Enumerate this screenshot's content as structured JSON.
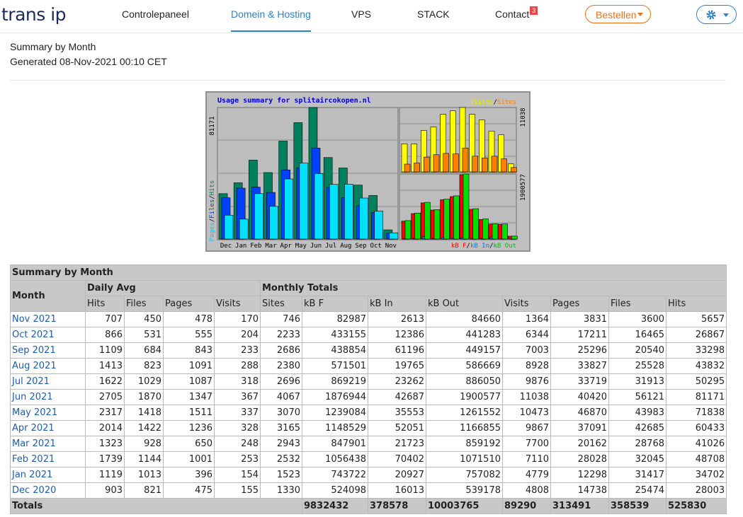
{
  "nav": {
    "logo": "trans ip",
    "items": [
      "Controlepaneel",
      "Domein & Hosting",
      "VPS",
      "STACK",
      "Contact"
    ],
    "contact_badge": "3",
    "order_label": "Bestellen"
  },
  "report": {
    "title": "Summary by Month",
    "generated": "Generated 08-Nov-2021 00:10 CET"
  },
  "colors": {
    "hits": "#00805c",
    "files": "#0040ff",
    "pages": "#00e0ff",
    "visits": "#ffff00",
    "sites": "#ff8000",
    "kbf": "#ff0000",
    "kbin": "#0080ff",
    "kbout": "#00e000"
  },
  "chart_data": {
    "type": "bar",
    "title": "Usage summary for splitaircokopen.nl",
    "categories": [
      "Dec",
      "Jan",
      "Feb",
      "Mar",
      "Apr",
      "May",
      "Jun",
      "Jul",
      "Aug",
      "Sep",
      "Oct",
      "Nov"
    ],
    "left_axis_max_label": "81171",
    "left_axis_legend": [
      "Pages",
      "Files",
      "Hits"
    ],
    "top_right_axis_max_label": "11038",
    "top_right_legend": [
      "Visits",
      "Sites"
    ],
    "bottom_right_axis_max_label": "1900577",
    "bottom_right_legend": [
      "kB F",
      "kB In",
      "kB Out"
    ],
    "series": [
      {
        "name": "Hits",
        "values": [
          28003,
          34702,
          48708,
          41026,
          60433,
          71838,
          81171,
          50295,
          43832,
          33298,
          26867,
          5657
        ]
      },
      {
        "name": "Files",
        "values": [
          25474,
          31417,
          32045,
          28768,
          42685,
          43983,
          56121,
          31913,
          25528,
          20540,
          16465,
          3600
        ]
      },
      {
        "name": "Pages",
        "values": [
          14738,
          12298,
          28028,
          20162,
          37091,
          46870,
          40420,
          33719,
          33827,
          25296,
          17211,
          3831
        ]
      },
      {
        "name": "Visits",
        "values": [
          4808,
          4779,
          7110,
          7700,
          9867,
          10473,
          11038,
          9876,
          8928,
          7003,
          6344,
          1364
        ]
      },
      {
        "name": "Sites",
        "values": [
          1330,
          1523,
          2532,
          2943,
          3165,
          3070,
          4067,
          2696,
          2380,
          2686,
          2233,
          746
        ]
      },
      {
        "name": "kB F",
        "values": [
          524098,
          743722,
          1056438,
          847901,
          1148529,
          1239084,
          1876944,
          869219,
          571501,
          438854,
          433155,
          82987
        ]
      },
      {
        "name": "kB In",
        "values": [
          16013,
          20927,
          70402,
          21723,
          52051,
          35553,
          42687,
          23262,
          19765,
          61196,
          12386,
          2613
        ]
      },
      {
        "name": "kB Out",
        "values": [
          539178,
          757082,
          1071510,
          859192,
          1166855,
          1261552,
          1900577,
          886050,
          586669,
          449157,
          441283,
          84660
        ]
      }
    ]
  },
  "table": {
    "caption": "Summary by Month",
    "month_header": "Month",
    "daily_avg_header": "Daily Avg",
    "monthly_totals_header": "Monthly Totals",
    "daily_cols": [
      "Hits",
      "Files",
      "Pages",
      "Visits"
    ],
    "monthly_cols": [
      "Sites",
      "kB F",
      "kB In",
      "kB Out",
      "Visits",
      "Pages",
      "Files",
      "Hits"
    ],
    "rows": [
      {
        "month": "Nov 2021",
        "cells": [
          "707",
          "450",
          "478",
          "170",
          "746",
          "82987",
          "2613",
          "84660",
          "1364",
          "3831",
          "3600",
          "5657"
        ]
      },
      {
        "month": "Oct 2021",
        "cells": [
          "866",
          "531",
          "555",
          "204",
          "2233",
          "433155",
          "12386",
          "441283",
          "6344",
          "17211",
          "16465",
          "26867"
        ]
      },
      {
        "month": "Sep 2021",
        "cells": [
          "1109",
          "684",
          "843",
          "233",
          "2686",
          "438854",
          "61196",
          "449157",
          "7003",
          "25296",
          "20540",
          "33298"
        ]
      },
      {
        "month": "Aug 2021",
        "cells": [
          "1413",
          "823",
          "1091",
          "288",
          "2380",
          "571501",
          "19765",
          "586669",
          "8928",
          "33827",
          "25528",
          "43832"
        ]
      },
      {
        "month": "Jul 2021",
        "cells": [
          "1622",
          "1029",
          "1087",
          "318",
          "2696",
          "869219",
          "23262",
          "886050",
          "9876",
          "33719",
          "31913",
          "50295"
        ]
      },
      {
        "month": "Jun 2021",
        "cells": [
          "2705",
          "1870",
          "1347",
          "367",
          "4067",
          "1876944",
          "42687",
          "1900577",
          "11038",
          "40420",
          "56121",
          "81171"
        ]
      },
      {
        "month": "May 2021",
        "cells": [
          "2317",
          "1418",
          "1511",
          "337",
          "3070",
          "1239084",
          "35553",
          "1261552",
          "10473",
          "46870",
          "43983",
          "71838"
        ]
      },
      {
        "month": "Apr 2021",
        "cells": [
          "2014",
          "1422",
          "1236",
          "328",
          "3165",
          "1148529",
          "52051",
          "1166855",
          "9867",
          "37091",
          "42685",
          "60433"
        ]
      },
      {
        "month": "Mar 2021",
        "cells": [
          "1323",
          "928",
          "650",
          "248",
          "2943",
          "847901",
          "21723",
          "859192",
          "7700",
          "20162",
          "28768",
          "41026"
        ]
      },
      {
        "month": "Feb 2021",
        "cells": [
          "1739",
          "1144",
          "1001",
          "253",
          "2532",
          "1056438",
          "70402",
          "1071510",
          "7110",
          "28028",
          "32045",
          "48708"
        ]
      },
      {
        "month": "Jan 2021",
        "cells": [
          "1119",
          "1013",
          "396",
          "154",
          "1523",
          "743722",
          "20927",
          "757082",
          "4779",
          "12298",
          "31417",
          "34702"
        ]
      },
      {
        "month": "Dec 2020",
        "cells": [
          "903",
          "821",
          "475",
          "155",
          "1330",
          "524098",
          "16013",
          "539178",
          "4808",
          "14738",
          "25474",
          "28003"
        ]
      }
    ],
    "totals_label": "Totals",
    "totals": [
      "9832432",
      "378578",
      "10003765",
      "89290",
      "313491",
      "358539",
      "525830"
    ]
  }
}
